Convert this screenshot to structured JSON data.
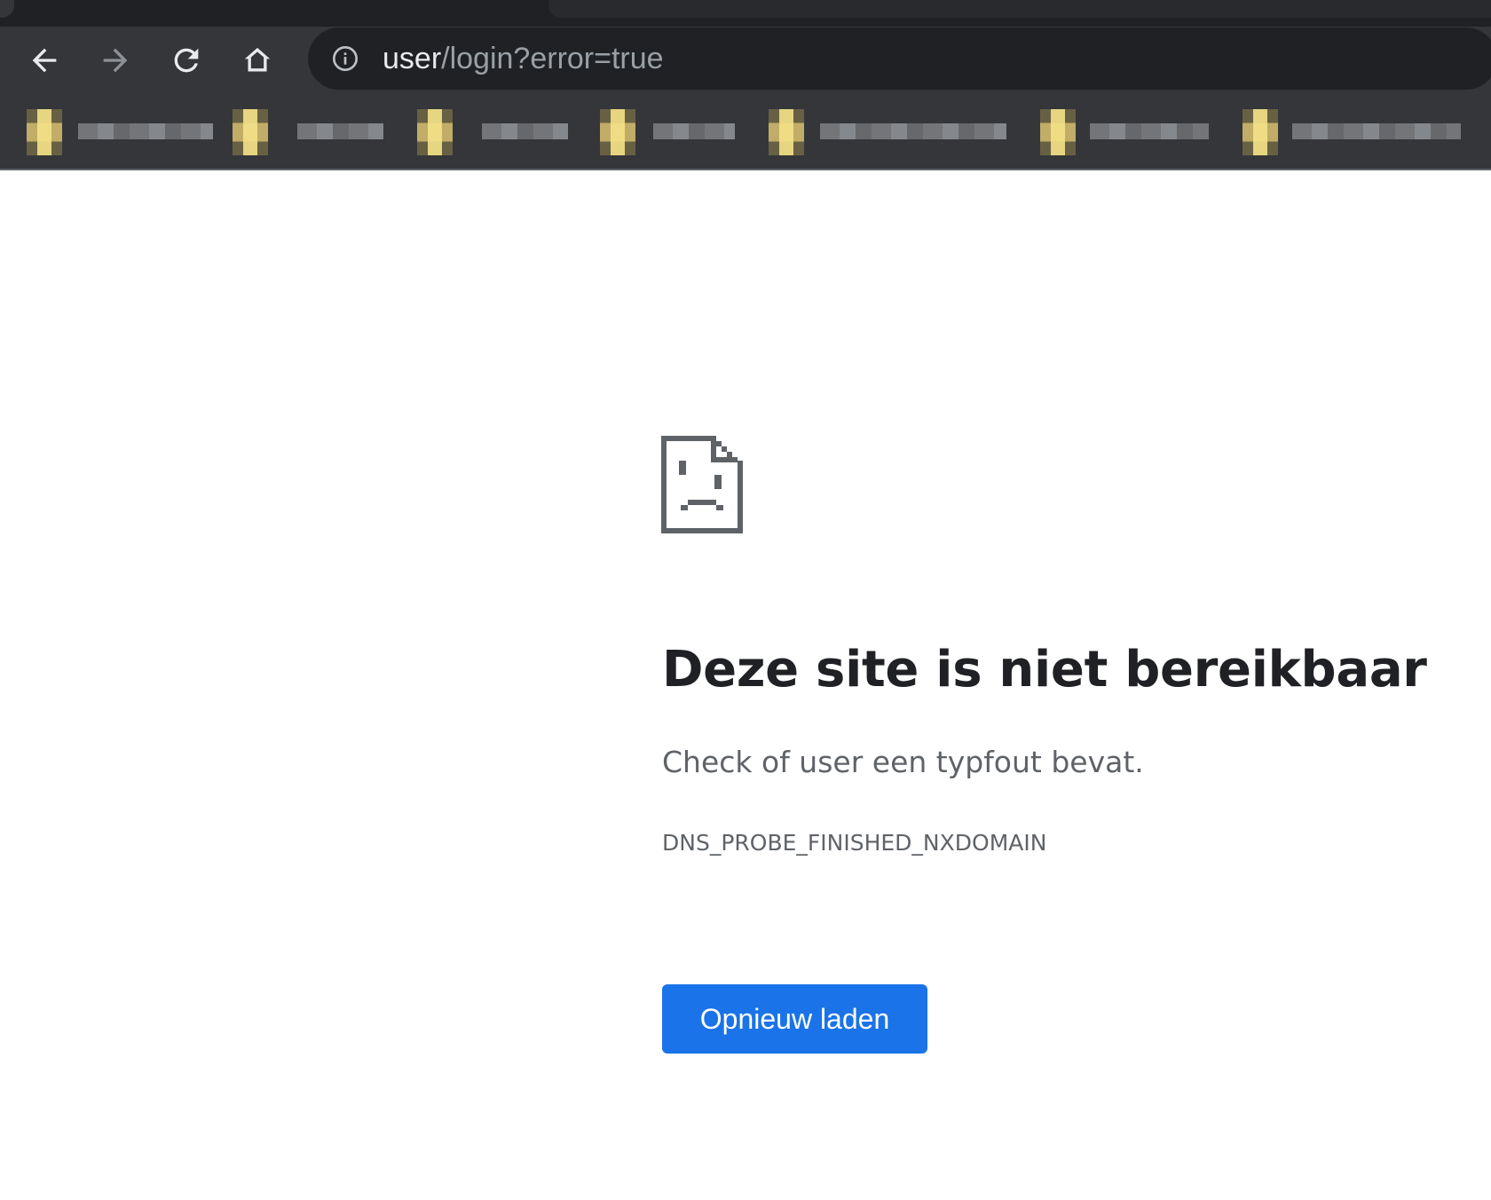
{
  "browser": {
    "address_bar": {
      "url_host": "user",
      "url_path": "/login?error=true"
    },
    "nav_icons": [
      "back-arrow-icon",
      "forward-arrow-icon",
      "reload-icon",
      "home-icon"
    ],
    "bookmarks_bar": {
      "items_visible": 7,
      "labels_blurred": true
    }
  },
  "error_page": {
    "icon": "sad-document-icon",
    "heading": "Deze site is niet bereikbaar",
    "suggestion": "Check of user een typfout bevat.",
    "error_code": "DNS_PROBE_FINISHED_NXDOMAIN",
    "reload_button_label": "Opnieuw laden"
  },
  "colors": {
    "chrome_dark": "#35363a",
    "omnibox_bg": "#202124",
    "button_blue": "#1a73e8",
    "heading_text": "#202124",
    "secondary_text": "#5f6368"
  }
}
